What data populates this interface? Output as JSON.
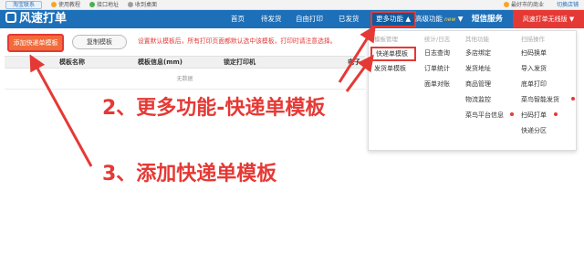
{
  "topbar": {
    "logo": "淘宝联系",
    "links": [
      "使用教程",
      "接口地址",
      "收到桌面"
    ],
    "user": "最好市的商业",
    "switch_shop": "切换店铺"
  },
  "nav": {
    "brand": "风速打单",
    "items": [
      "首页",
      "待发货",
      "自由打印",
      "已发货"
    ],
    "more": "更多功能",
    "advanced": "高级功能",
    "advanced_badge": "new",
    "sms": "短信服务",
    "wireless": "风速打单无线版"
  },
  "toolbar": {
    "add_template": "添加快递单模板",
    "copy_template": "复制模板",
    "tip": "设置默认模板后，所有打印页面都默认选中该模板，打印时请注意选择。"
  },
  "table": {
    "headers": [
      "模板名称",
      "模板信息(mm)",
      "锁定打印机",
      "电子"
    ],
    "empty": "无数据"
  },
  "dropdown": {
    "columns": [
      {
        "header": "模板管理",
        "items": [
          "快递单模板",
          "发货单模板"
        ]
      },
      {
        "header": "统计/日志",
        "items": [
          "日志查询",
          "订单统计",
          "面单对账"
        ]
      },
      {
        "header": "其他功能",
        "items": [
          "多店绑定",
          "发货地址",
          "商品管理",
          "物流监控",
          "菜鸟平台信息"
        ]
      },
      {
        "header": "扫描操作",
        "items": [
          "扫码换单",
          "导入发货",
          "底单打印",
          "菜鸟智能发货",
          "扫码打单",
          "快递分区"
        ]
      }
    ]
  },
  "annotations": {
    "step2": "2、更多功能-快递单模板",
    "step3": "3、添加快递单模板"
  },
  "colors": {
    "nav": "#1d6fb8",
    "accent_red": "#e53935",
    "add_button": "#f26b3a"
  }
}
